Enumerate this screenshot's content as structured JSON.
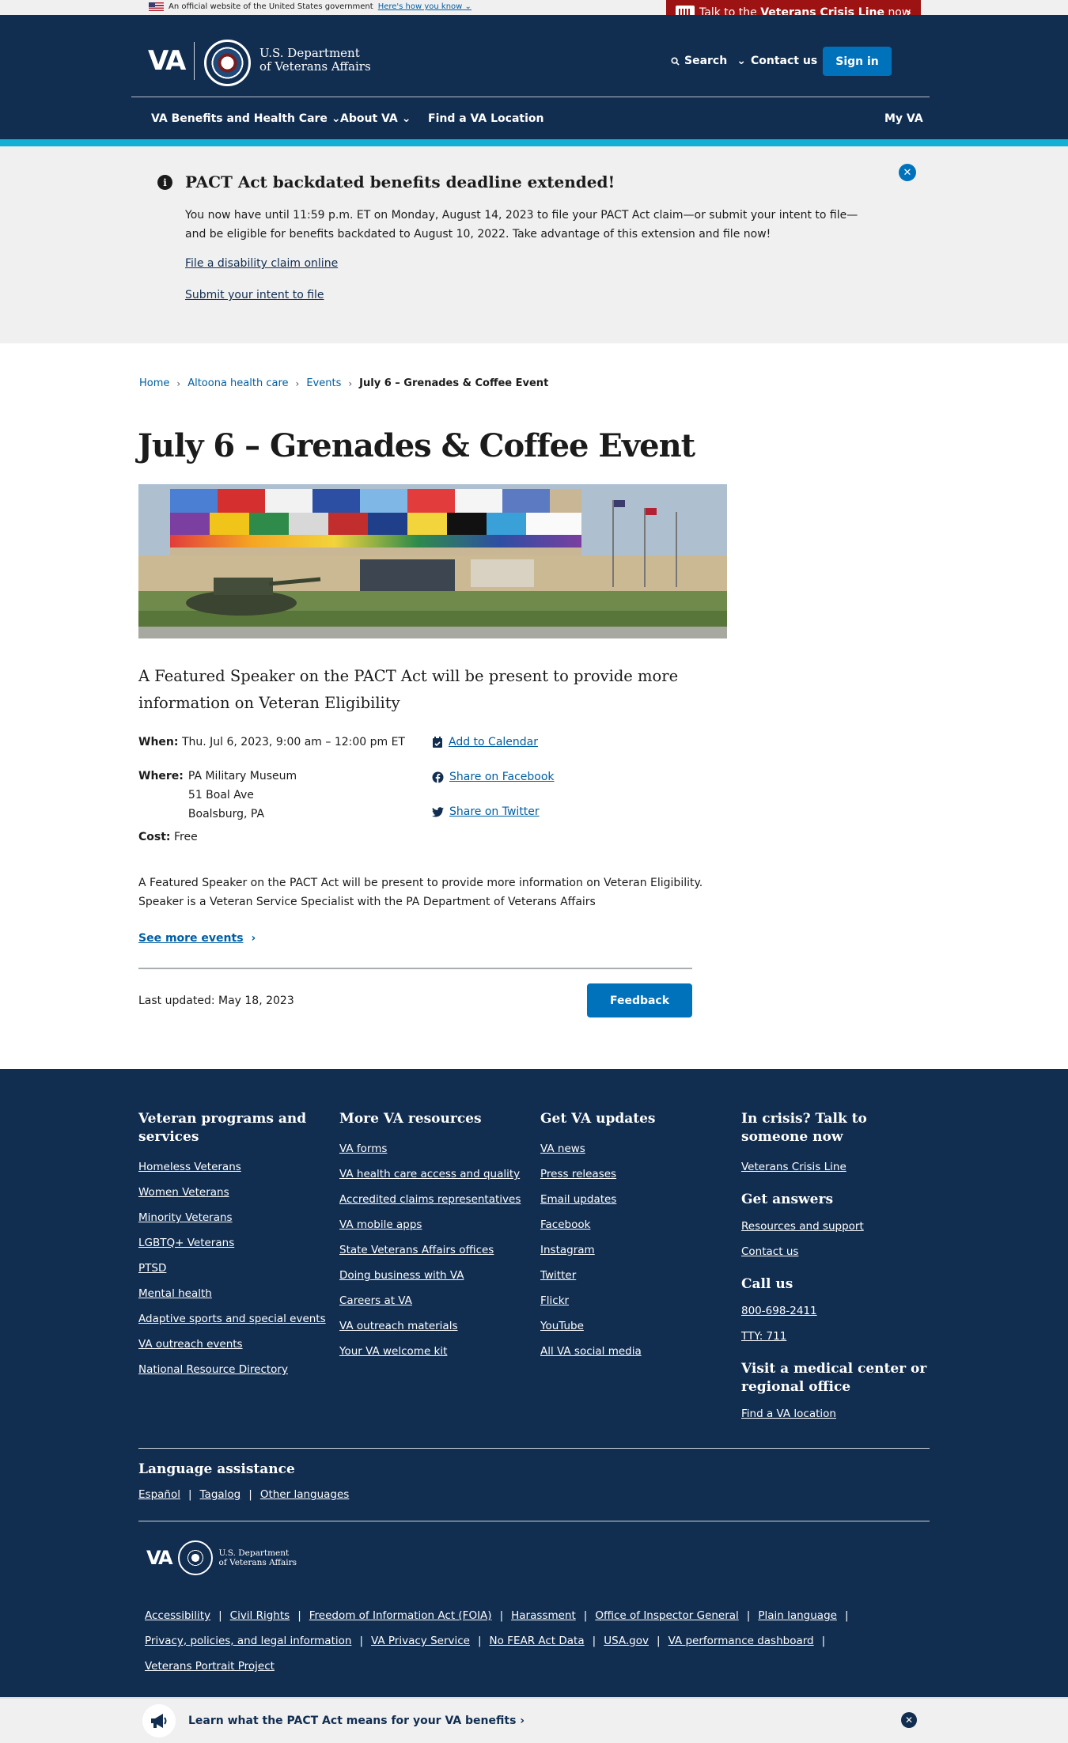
{
  "gov_banner": {
    "text": "An official website of the United States government",
    "link": "Here's how you know"
  },
  "crisis": {
    "prefix": "Talk to the ",
    "bold": "Veterans Crisis Line",
    "suffix": " now"
  },
  "header": {
    "logo": "VA",
    "dept_line1": "U.S. Department",
    "dept_line2": "of Veterans Affairs",
    "search": "Search",
    "contact": "Contact us",
    "signin": "Sign in",
    "nav": {
      "benefits": "VA Benefits and Health Care",
      "about": "About VA",
      "find": "Find a VA Location",
      "myva": "My VA"
    }
  },
  "alert": {
    "title": "PACT Act backdated benefits deadline extended!",
    "body": "You now have until 11:59 p.m. ET on Monday, August 14, 2023 to file your PACT Act claim—or submit your intent to file—and be eligible for benefits backdated to August 10, 2022. Take advantage of this extension and file now!",
    "link1": "File a disability claim online",
    "link2": "Submit your intent to file"
  },
  "breadcrumb": {
    "home": "Home",
    "facility": "Altoona health care",
    "events": "Events",
    "current": "July 6 – Grenades & Coffee Event"
  },
  "page": {
    "title": "July 6 – Grenades & Coffee Event",
    "description": "A Featured Speaker on the PACT Act will be present to provide more information on Veteran Eligibility",
    "when_label": "When:",
    "when_value": "Thu. Jul 6, 2023, 9:00 am – 12:00 pm ET",
    "where_label": "Where:",
    "where_line1": "PA Military Museum",
    "where_line2": "51 Boal Ave",
    "where_line3": "Boalsburg, PA",
    "cost_label": "Cost:",
    "cost_value": "Free",
    "add_calendar": "Add to Calendar",
    "share_facebook": "Share on Facebook",
    "share_twitter": "Share on Twitter",
    "long_desc": "A Featured Speaker on the PACT Act will be present to provide more information on Veteran Eligibility. Speaker is a Veteran Service Specialist with the PA Department of Veterans Affairs",
    "see_more": "See more events",
    "last_updated": "Last updated: May 18, 2023",
    "feedback": "Feedback"
  },
  "footer": {
    "col1": {
      "title": "Veteran programs and services",
      "links": [
        "Homeless Veterans",
        "Women Veterans",
        "Minority Veterans",
        "LGBTQ+ Veterans",
        "PTSD",
        "Mental health",
        "Adaptive sports and special events",
        "VA outreach events",
        "National Resource Directory"
      ]
    },
    "col2": {
      "title": "More VA resources",
      "links": [
        "VA forms",
        "VA health care access and quality",
        "Accredited claims representatives",
        "VA mobile apps",
        "State Veterans Affairs offices",
        "Doing business with VA",
        "Careers at VA",
        "VA outreach materials",
        "Your VA welcome kit"
      ]
    },
    "col3": {
      "title": "Get VA updates",
      "links": [
        "VA news",
        "Press releases",
        "Email updates",
        "Facebook",
        "Instagram",
        "Twitter",
        "Flickr",
        "YouTube",
        "All VA social media"
      ]
    },
    "col4": {
      "crisis_title": "In crisis? Talk to someone now",
      "crisis_link": "Veterans Crisis Line",
      "answers_title": "Get answers",
      "answers_links": [
        "Resources and support",
        "Contact us"
      ],
      "call_title": "Call us",
      "call_links": [
        "800-698-2411",
        "TTY: 711"
      ],
      "visit_title": "Visit a medical center or regional office",
      "visit_link": "Find a VA location"
    },
    "language": {
      "title": "Language assistance",
      "links": [
        "Español",
        "Tagalog",
        "Other languages"
      ]
    },
    "logo": {
      "va": "VA",
      "line1": "U.S. Department",
      "line2": "of Veterans Affairs"
    },
    "bottom_links": [
      "Accessibility",
      "Civil Rights",
      "Freedom of Information Act (FOIA)",
      "Harassment",
      "Office of Inspector General",
      "Plain language",
      "Privacy, policies, and legal information",
      "VA Privacy Service",
      "No FEAR Act Data",
      "USA.gov",
      "VA performance dashboard",
      "Veterans Portrait Project"
    ]
  },
  "promo": {
    "text": "Learn what the PACT Act means for your VA benefits"
  },
  "colors": {
    "navy": "#112e51",
    "primary": "#0071bb",
    "crisis_red": "#9d1313",
    "stripe": "#14b0d4",
    "link": "#005ea2"
  }
}
